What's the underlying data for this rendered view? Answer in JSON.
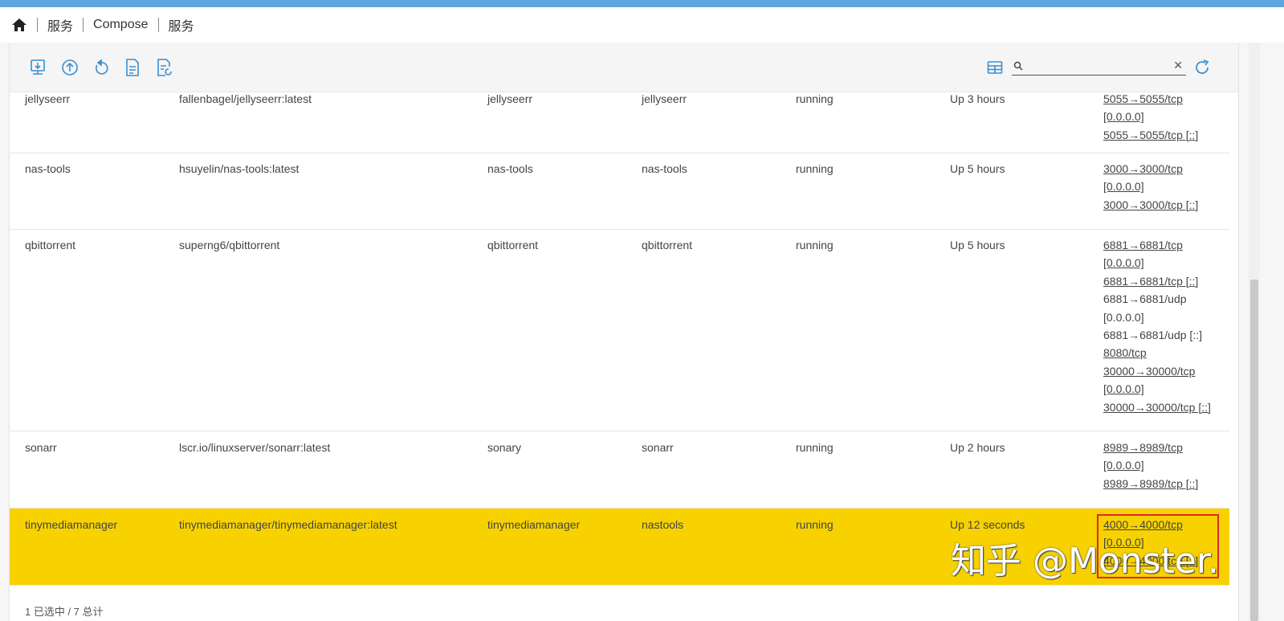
{
  "breadcrumb": [
    "服务",
    "Compose",
    "服务"
  ],
  "search": {
    "value": "",
    "placeholder": ""
  },
  "rows": [
    {
      "name": "jellyseerr",
      "image": "fallenbagel/jellyseerr:latest",
      "service": "jellyseerr",
      "project": "jellyseerr",
      "state": "running",
      "status": "Up 3 hours",
      "ports": [
        {
          "text": "5055→5055/tcp",
          "link": true
        },
        {
          "text": "[0.0.0.0]",
          "link": true
        },
        {
          "text": "5055→5055/tcp [::]",
          "link": true
        }
      ]
    },
    {
      "name": "nas-tools",
      "image": "hsuyelin/nas-tools:latest",
      "service": "nas-tools",
      "project": "nas-tools",
      "state": "running",
      "status": "Up 5 hours",
      "ports": [
        {
          "text": "3000→3000/tcp",
          "link": true
        },
        {
          "text": "[0.0.0.0]",
          "link": true
        },
        {
          "text": "3000→3000/tcp [::]",
          "link": true
        }
      ]
    },
    {
      "name": "qbittorrent",
      "image": "superng6/qbittorrent",
      "service": "qbittorrent",
      "project": "qbittorrent",
      "state": "running",
      "status": "Up 5 hours",
      "ports": [
        {
          "text": "6881→6881/tcp",
          "link": true
        },
        {
          "text": "[0.0.0.0]",
          "link": true
        },
        {
          "text": "6881→6881/tcp [::]",
          "link": true
        },
        {
          "text": "6881→6881/udp",
          "link": false
        },
        {
          "text": "[0.0.0.0]",
          "link": false
        },
        {
          "text": "6881→6881/udp [::]",
          "link": false
        },
        {
          "text": "8080/tcp",
          "link": true
        },
        {
          "text": "30000→30000/tcp",
          "link": true
        },
        {
          "text": "[0.0.0.0]",
          "link": true
        },
        {
          "text": "30000→30000/tcp [::]",
          "link": true
        }
      ]
    },
    {
      "name": "sonarr",
      "image": "lscr.io/linuxserver/sonarr:latest",
      "service": "sonary",
      "project": "sonarr",
      "state": "running",
      "status": "Up 2 hours",
      "ports": [
        {
          "text": "8989→8989/tcp",
          "link": true
        },
        {
          "text": "[0.0.0.0]",
          "link": true
        },
        {
          "text": "8989→8989/tcp [::]",
          "link": true
        }
      ]
    },
    {
      "name": "tinymediamanager",
      "image": "tinymediamanager/tinymediamanager:latest",
      "service": "tinymediamanager",
      "project": "nastools",
      "state": "running",
      "status": "Up 12 seconds",
      "selected": true,
      "ports": [
        {
          "text": "4000→4000/tcp",
          "link": true
        },
        {
          "text": "[0.0.0.0]",
          "link": true
        },
        {
          "text": "4000→4000/tcp [::]",
          "link": true
        }
      ]
    }
  ],
  "footer": {
    "selection": "1 已选中 / 7 总计"
  },
  "watermark": "知乎 @Monster.",
  "colors": {
    "accent": "#5aa6e0",
    "selected_row": "#f7d200",
    "highlight_box": "#e0262b"
  }
}
